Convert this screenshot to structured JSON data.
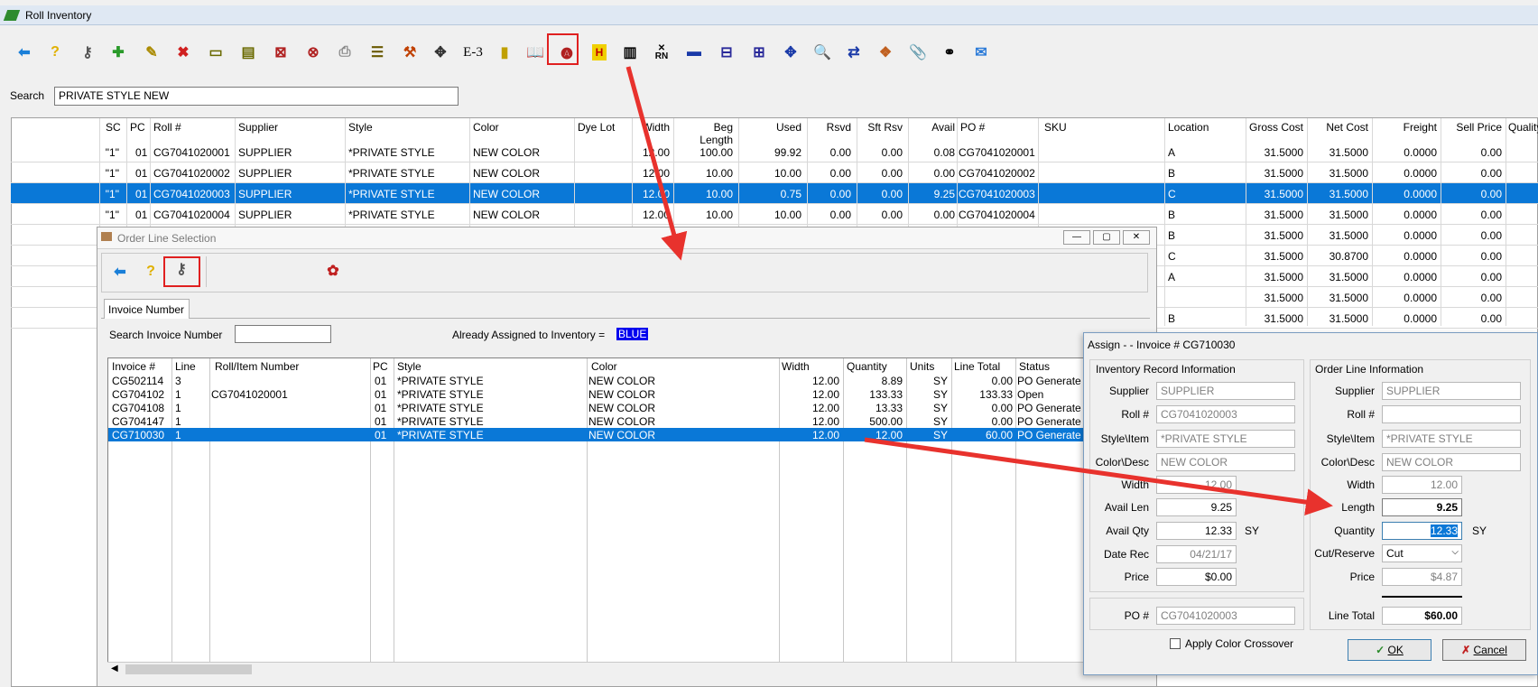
{
  "window": {
    "title": "Roll Inventory"
  },
  "toolbar": {
    "e3_label": "E-3",
    "rn_label": "RN"
  },
  "search": {
    "label": "Search",
    "value": "PRIVATE STYLE NEW"
  },
  "grid": {
    "columns": [
      "SC",
      "PC",
      "Roll #",
      "Supplier",
      "Style",
      "Color",
      "Dye Lot",
      "Width",
      "Beg Length",
      "Used",
      "Rsvd",
      "Sft Rsv",
      "Avail",
      "PO #",
      "SKU",
      "Location",
      "Gross Cost",
      "Net Cost",
      "Freight",
      "Sell Price",
      "Quality"
    ],
    "rows": [
      {
        "sc": "\"1\"",
        "pc": "01",
        "roll": "CG7041020001",
        "supplier": "SUPPLIER",
        "style": "*PRIVATE STYLE",
        "color": "NEW COLOR",
        "width": "12.00",
        "beg": "100.00",
        "used": "99.92",
        "rsvd": "0.00",
        "sft": "0.00",
        "avail": "0.08",
        "po": "CG7041020001",
        "loc": "A",
        "gross": "31.5000",
        "net": "31.5000",
        "freight": "0.0000",
        "sell": "0.00"
      },
      {
        "sc": "\"1\"",
        "pc": "01",
        "roll": "CG7041020002",
        "supplier": "SUPPLIER",
        "style": "*PRIVATE STYLE",
        "color": "NEW COLOR",
        "width": "12.00",
        "beg": "10.00",
        "used": "10.00",
        "rsvd": "0.00",
        "sft": "0.00",
        "avail": "0.00",
        "po": "CG7041020002",
        "loc": "B",
        "gross": "31.5000",
        "net": "31.5000",
        "freight": "0.0000",
        "sell": "0.00"
      },
      {
        "sc": "\"1\"",
        "pc": "01",
        "roll": "CG7041020003",
        "supplier": "SUPPLIER",
        "style": "*PRIVATE STYLE",
        "color": "NEW COLOR",
        "width": "12.00",
        "beg": "10.00",
        "used": "0.75",
        "rsvd": "0.00",
        "sft": "0.00",
        "avail": "9.25",
        "po": "CG7041020003",
        "loc": "C",
        "gross": "31.5000",
        "net": "31.5000",
        "freight": "0.0000",
        "sell": "0.00"
      },
      {
        "sc": "\"1\"",
        "pc": "01",
        "roll": "CG7041020004",
        "supplier": "SUPPLIER",
        "style": "*PRIVATE STYLE",
        "color": "NEW COLOR",
        "width": "12.00",
        "beg": "10.00",
        "used": "10.00",
        "rsvd": "0.00",
        "sft": "0.00",
        "avail": "0.00",
        "po": "CG7041020004",
        "loc": "B",
        "gross": "31.5000",
        "net": "31.5000",
        "freight": "0.0000",
        "sell": "0.00"
      },
      {
        "loc": "B",
        "gross": "31.5000",
        "net": "31.5000",
        "freight": "0.0000",
        "sell": "0.00"
      },
      {
        "loc": "C",
        "gross": "31.5000",
        "net": "30.8700",
        "freight": "0.0000",
        "sell": "0.00"
      },
      {
        "loc": "A",
        "gross": "31.5000",
        "net": "31.5000",
        "freight": "0.0000",
        "sell": "0.00"
      },
      {
        "loc": "",
        "gross": "31.5000",
        "net": "31.5000",
        "freight": "0.0000",
        "sell": "0.00"
      },
      {
        "loc": "B",
        "gross": "31.5000",
        "net": "31.5000",
        "freight": "0.0000",
        "sell": "0.00"
      }
    ]
  },
  "order_dialog": {
    "title": "Order Line Selection",
    "tab": "Invoice Number",
    "search_label": "Search Invoice Number",
    "search_value": "",
    "assigned_label": "Already Assigned to Inventory =",
    "assigned_badge": "BLUE",
    "columns": [
      "Invoice #",
      "Line",
      "Roll/Item Number",
      "PC",
      "Style",
      "Color",
      "Width",
      "Quantity",
      "Units",
      "Line Total",
      "Status"
    ],
    "rows": [
      {
        "inv": "CG502114",
        "line": "3",
        "roll": "",
        "pc": "01",
        "style": "*PRIVATE STYLE",
        "color": "NEW COLOR",
        "width": "12.00",
        "qty": "8.89",
        "units": "SY",
        "total": "0.00",
        "status": "PO Generate"
      },
      {
        "inv": "CG704102",
        "line": "1",
        "roll": "CG7041020001",
        "pc": "01",
        "style": "*PRIVATE STYLE",
        "color": "NEW COLOR",
        "width": "12.00",
        "qty": "133.33",
        "units": "SY",
        "total": "133.33",
        "status": "Open"
      },
      {
        "inv": "CG704108",
        "line": "1",
        "roll": "",
        "pc": "01",
        "style": "*PRIVATE STYLE",
        "color": "NEW COLOR",
        "width": "12.00",
        "qty": "13.33",
        "units": "SY",
        "total": "0.00",
        "status": "PO Generate"
      },
      {
        "inv": "CG704147",
        "line": "1",
        "roll": "",
        "pc": "01",
        "style": "*PRIVATE STYLE",
        "color": "NEW COLOR",
        "width": "12.00",
        "qty": "500.00",
        "units": "SY",
        "total": "0.00",
        "status": "PO Generate"
      },
      {
        "inv": "CG710030",
        "line": "1",
        "roll": "",
        "pc": "01",
        "style": "*PRIVATE STYLE",
        "color": "NEW COLOR",
        "width": "12.00",
        "qty": "12.00",
        "units": "SY",
        "total": "60.00",
        "status": "PO Generate"
      }
    ]
  },
  "assign_dialog": {
    "title": "Assign - - Invoice # CG710030",
    "inv_group": "Inventory Record Information",
    "ord_group": "Order Line Information",
    "labels": {
      "supplier": "Supplier",
      "roll": "Roll #",
      "style": "Style\\Item",
      "color": "Color\\Desc",
      "width": "Width",
      "avail_len": "Avail Len",
      "avail_qty": "Avail Qty",
      "date_rec": "Date Rec",
      "price": "Price",
      "po": "PO #",
      "length": "Length",
      "quantity": "Quantity",
      "cut_reserve": "Cut/Reserve",
      "line_total": "Line Total",
      "units": "SY"
    },
    "inv": {
      "supplier": "SUPPLIER",
      "roll": "CG7041020003",
      "style": "*PRIVATE STYLE",
      "color": "NEW COLOR",
      "width": "12.00",
      "avail_len": "9.25",
      "avail_qty": "12.33",
      "date_rec": "04/21/17",
      "price": "$0.00",
      "po": "CG7041020003"
    },
    "ord": {
      "supplier": "SUPPLIER",
      "roll": "",
      "style": "*PRIVATE STYLE",
      "color": "NEW COLOR",
      "width": "12.00",
      "length": "9.25",
      "quantity": "12.33",
      "cut_reserve": "Cut",
      "price": "$4.87",
      "line_total": "$60.00"
    },
    "apply_color": "Apply Color Crossover",
    "ok": "OK",
    "cancel": "Cancel"
  },
  "colors": {
    "selection": "#0a78d7",
    "highlight_box": "#e02020",
    "arrow": "#e8322d",
    "badge": "#0000ee"
  }
}
